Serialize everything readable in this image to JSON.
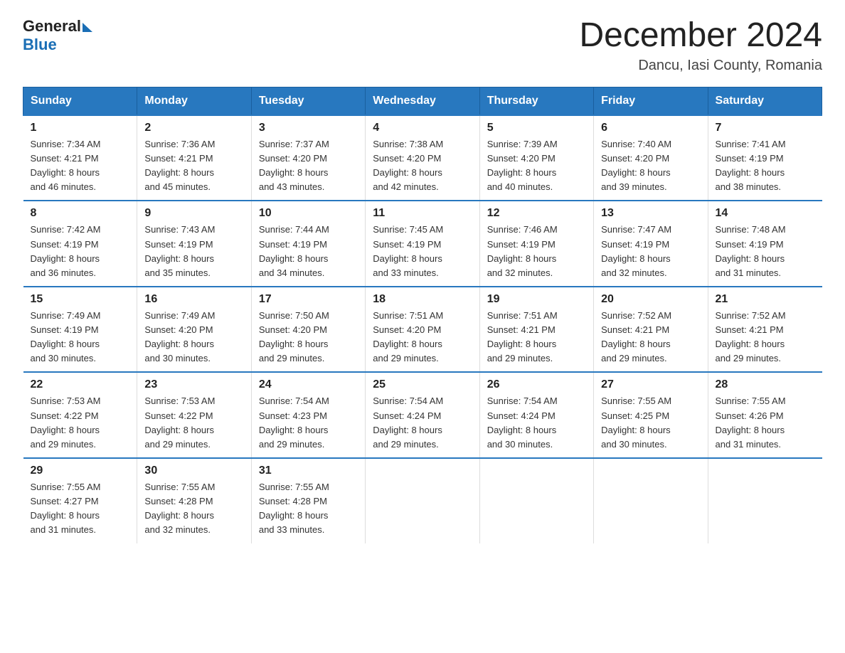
{
  "logo": {
    "general": "General",
    "blue": "Blue"
  },
  "title": "December 2024",
  "subtitle": "Dancu, Iasi County, Romania",
  "days_of_week": [
    "Sunday",
    "Monday",
    "Tuesday",
    "Wednesday",
    "Thursday",
    "Friday",
    "Saturday"
  ],
  "weeks": [
    [
      {
        "day": "1",
        "sunrise": "7:34 AM",
        "sunset": "4:21 PM",
        "daylight": "8 hours and 46 minutes."
      },
      {
        "day": "2",
        "sunrise": "7:36 AM",
        "sunset": "4:21 PM",
        "daylight": "8 hours and 45 minutes."
      },
      {
        "day": "3",
        "sunrise": "7:37 AM",
        "sunset": "4:20 PM",
        "daylight": "8 hours and 43 minutes."
      },
      {
        "day": "4",
        "sunrise": "7:38 AM",
        "sunset": "4:20 PM",
        "daylight": "8 hours and 42 minutes."
      },
      {
        "day": "5",
        "sunrise": "7:39 AM",
        "sunset": "4:20 PM",
        "daylight": "8 hours and 40 minutes."
      },
      {
        "day": "6",
        "sunrise": "7:40 AM",
        "sunset": "4:20 PM",
        "daylight": "8 hours and 39 minutes."
      },
      {
        "day": "7",
        "sunrise": "7:41 AM",
        "sunset": "4:19 PM",
        "daylight": "8 hours and 38 minutes."
      }
    ],
    [
      {
        "day": "8",
        "sunrise": "7:42 AM",
        "sunset": "4:19 PM",
        "daylight": "8 hours and 36 minutes."
      },
      {
        "day": "9",
        "sunrise": "7:43 AM",
        "sunset": "4:19 PM",
        "daylight": "8 hours and 35 minutes."
      },
      {
        "day": "10",
        "sunrise": "7:44 AM",
        "sunset": "4:19 PM",
        "daylight": "8 hours and 34 minutes."
      },
      {
        "day": "11",
        "sunrise": "7:45 AM",
        "sunset": "4:19 PM",
        "daylight": "8 hours and 33 minutes."
      },
      {
        "day": "12",
        "sunrise": "7:46 AM",
        "sunset": "4:19 PM",
        "daylight": "8 hours and 32 minutes."
      },
      {
        "day": "13",
        "sunrise": "7:47 AM",
        "sunset": "4:19 PM",
        "daylight": "8 hours and 32 minutes."
      },
      {
        "day": "14",
        "sunrise": "7:48 AM",
        "sunset": "4:19 PM",
        "daylight": "8 hours and 31 minutes."
      }
    ],
    [
      {
        "day": "15",
        "sunrise": "7:49 AM",
        "sunset": "4:19 PM",
        "daylight": "8 hours and 30 minutes."
      },
      {
        "day": "16",
        "sunrise": "7:49 AM",
        "sunset": "4:20 PM",
        "daylight": "8 hours and 30 minutes."
      },
      {
        "day": "17",
        "sunrise": "7:50 AM",
        "sunset": "4:20 PM",
        "daylight": "8 hours and 29 minutes."
      },
      {
        "day": "18",
        "sunrise": "7:51 AM",
        "sunset": "4:20 PM",
        "daylight": "8 hours and 29 minutes."
      },
      {
        "day": "19",
        "sunrise": "7:51 AM",
        "sunset": "4:21 PM",
        "daylight": "8 hours and 29 minutes."
      },
      {
        "day": "20",
        "sunrise": "7:52 AM",
        "sunset": "4:21 PM",
        "daylight": "8 hours and 29 minutes."
      },
      {
        "day": "21",
        "sunrise": "7:52 AM",
        "sunset": "4:21 PM",
        "daylight": "8 hours and 29 minutes."
      }
    ],
    [
      {
        "day": "22",
        "sunrise": "7:53 AM",
        "sunset": "4:22 PM",
        "daylight": "8 hours and 29 minutes."
      },
      {
        "day": "23",
        "sunrise": "7:53 AM",
        "sunset": "4:22 PM",
        "daylight": "8 hours and 29 minutes."
      },
      {
        "day": "24",
        "sunrise": "7:54 AM",
        "sunset": "4:23 PM",
        "daylight": "8 hours and 29 minutes."
      },
      {
        "day": "25",
        "sunrise": "7:54 AM",
        "sunset": "4:24 PM",
        "daylight": "8 hours and 29 minutes."
      },
      {
        "day": "26",
        "sunrise": "7:54 AM",
        "sunset": "4:24 PM",
        "daylight": "8 hours and 30 minutes."
      },
      {
        "day": "27",
        "sunrise": "7:55 AM",
        "sunset": "4:25 PM",
        "daylight": "8 hours and 30 minutes."
      },
      {
        "day": "28",
        "sunrise": "7:55 AM",
        "sunset": "4:26 PM",
        "daylight": "8 hours and 31 minutes."
      }
    ],
    [
      {
        "day": "29",
        "sunrise": "7:55 AM",
        "sunset": "4:27 PM",
        "daylight": "8 hours and 31 minutes."
      },
      {
        "day": "30",
        "sunrise": "7:55 AM",
        "sunset": "4:28 PM",
        "daylight": "8 hours and 32 minutes."
      },
      {
        "day": "31",
        "sunrise": "7:55 AM",
        "sunset": "4:28 PM",
        "daylight": "8 hours and 33 minutes."
      },
      null,
      null,
      null,
      null
    ]
  ],
  "labels": {
    "sunrise": "Sunrise:",
    "sunset": "Sunset:",
    "daylight": "Daylight:"
  }
}
